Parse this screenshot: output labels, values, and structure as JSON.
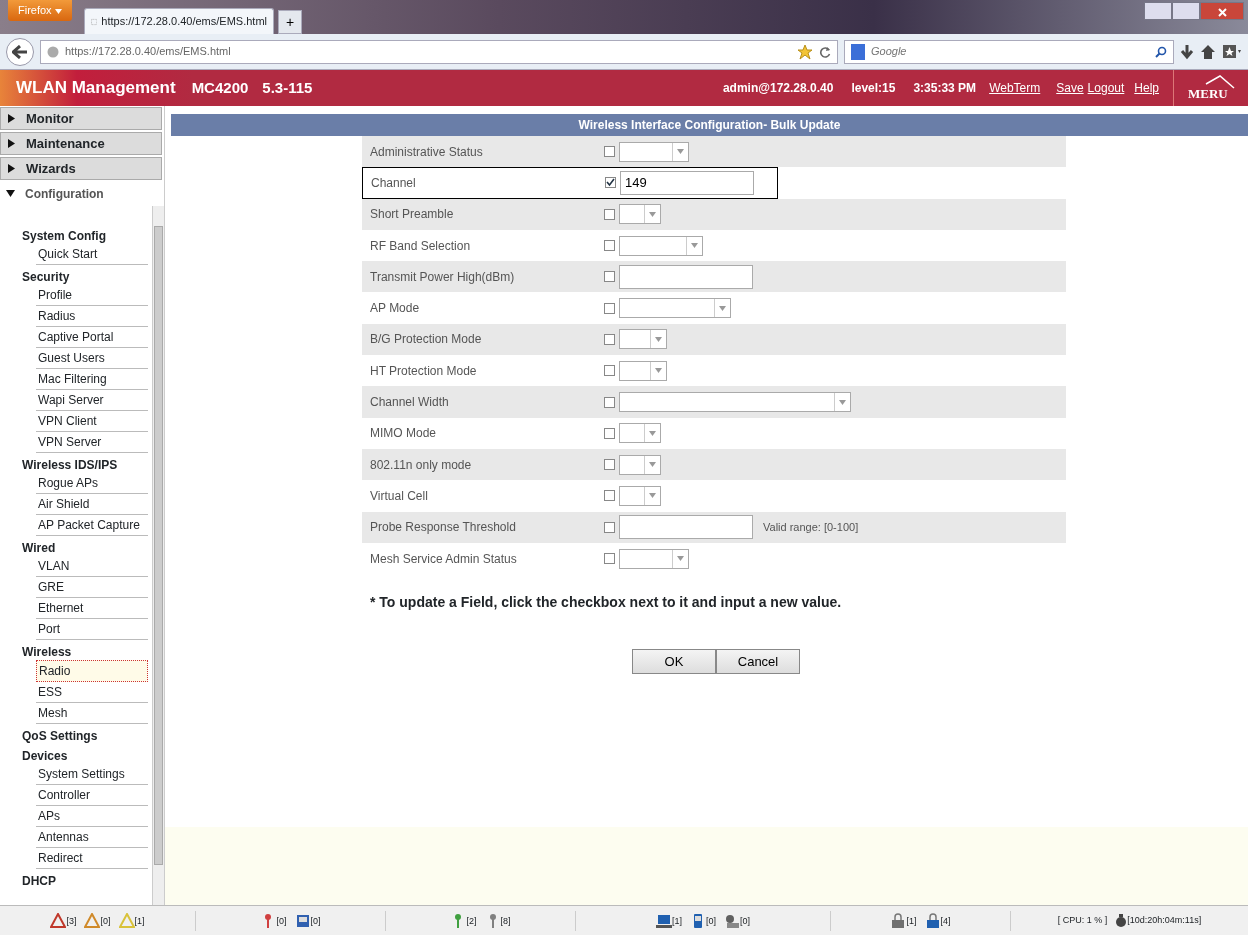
{
  "browser": {
    "menu_button": "Firefox",
    "tab_title": "https://172.28.0.40/ems/EMS.html",
    "new_tab": "+",
    "address": "https://172.28.0.40/ems/EMS.html",
    "search_placeholder": "Google"
  },
  "header": {
    "title": "WLAN Management",
    "model": "MC4200",
    "version": "5.3-115",
    "user": "admin@172.28.0.40",
    "level": "level:15",
    "time": "3:35:33 PM",
    "links": [
      "WebTerm",
      "Save",
      "Logout",
      "Help"
    ],
    "logo": "MERU"
  },
  "sidebar": {
    "sections": [
      {
        "label": "Monitor",
        "expanded": false
      },
      {
        "label": "Maintenance",
        "expanded": false
      },
      {
        "label": "Wizards",
        "expanded": false
      },
      {
        "label": "Configuration",
        "expanded": true
      }
    ],
    "groups": [
      {
        "label": "System Config",
        "children": [
          {
            "label": "Quick Start",
            "selected": false
          }
        ]
      },
      {
        "label": "Security",
        "children": [
          {
            "label": "Profile",
            "selected": false
          },
          {
            "label": "Radius",
            "selected": false
          },
          {
            "label": "Captive Portal",
            "selected": false
          },
          {
            "label": "Guest Users",
            "selected": false
          },
          {
            "label": "Mac Filtering",
            "selected": false
          },
          {
            "label": "Wapi Server",
            "selected": false
          },
          {
            "label": "VPN Client",
            "selected": false
          },
          {
            "label": "VPN Server",
            "selected": false
          }
        ]
      },
      {
        "label": "Wireless IDS/IPS",
        "children": [
          {
            "label": "Rogue APs",
            "selected": false
          },
          {
            "label": "Air Shield",
            "selected": false
          },
          {
            "label": "AP Packet Capture",
            "selected": false
          }
        ]
      },
      {
        "label": "Wired",
        "children": [
          {
            "label": "VLAN",
            "selected": false
          },
          {
            "label": "GRE",
            "selected": false
          },
          {
            "label": "Ethernet",
            "selected": false
          },
          {
            "label": "Port",
            "selected": false
          }
        ]
      },
      {
        "label": "Wireless",
        "children": [
          {
            "label": "Radio",
            "selected": true
          },
          {
            "label": "ESS",
            "selected": false
          },
          {
            "label": "Mesh",
            "selected": false
          }
        ]
      },
      {
        "label": "QoS Settings"
      },
      {
        "label": "Devices",
        "children": [
          {
            "label": "System Settings",
            "selected": false
          },
          {
            "label": "Controller",
            "selected": false
          },
          {
            "label": "APs",
            "selected": false
          },
          {
            "label": "Antennas",
            "selected": false
          },
          {
            "label": "Redirect",
            "selected": false
          }
        ]
      },
      {
        "label": "DHCP"
      }
    ]
  },
  "form": {
    "title": "Wireless Interface Configuration- Bulk Update",
    "rows": [
      {
        "label": "Administrative Status",
        "kind": "select",
        "checked": false,
        "outlined": false
      },
      {
        "label": "Channel",
        "kind": "text",
        "checked": true,
        "value": "149",
        "outlined": true
      },
      {
        "label": "Short Preamble",
        "kind": "select",
        "checked": false,
        "outlined": false
      },
      {
        "label": "RF Band Selection",
        "kind": "select",
        "checked": false,
        "outlined": false
      },
      {
        "label": "Transmit Power High(dBm)",
        "kind": "text",
        "checked": false,
        "outlined": false
      },
      {
        "label": "AP Mode",
        "kind": "select",
        "checked": false,
        "outlined": false
      },
      {
        "label": "B/G Protection Mode",
        "kind": "select",
        "checked": false,
        "outlined": false
      },
      {
        "label": "HT Protection Mode",
        "kind": "select",
        "checked": false,
        "outlined": false
      },
      {
        "label": "Channel Width",
        "kind": "select",
        "checked": false,
        "outlined": false
      },
      {
        "label": "MIMO Mode",
        "kind": "select",
        "checked": false,
        "outlined": false
      },
      {
        "label": "802.11n only mode",
        "kind": "select",
        "checked": false,
        "outlined": false
      },
      {
        "label": "Virtual Cell",
        "kind": "select",
        "checked": false,
        "outlined": false
      },
      {
        "label": "Probe Response Threshold",
        "kind": "text",
        "checked": false,
        "hint": "Valid range: [0-100]",
        "outlined": false
      },
      {
        "label": "Mesh Service Admin Status",
        "kind": "select",
        "checked": false,
        "outlined": false
      }
    ],
    "note": "* To update a Field, click the checkbox next to it and input a new value.",
    "buttons": [
      "OK",
      "Cancel"
    ]
  },
  "status_bar": {
    "groups": [
      [
        {
          "kind": "warning",
          "color": "#c0392b",
          "count": "[3]"
        },
        {
          "kind": "warning",
          "color": "#d08a2a",
          "count": "[0]"
        },
        {
          "kind": "warning",
          "color": "#d9c23a",
          "count": "[1]"
        }
      ],
      [
        {
          "kind": "ap",
          "color": "#d04040",
          "count": "[0]"
        },
        {
          "kind": "radio",
          "color": "#3060b0",
          "count": "[0]"
        }
      ],
      [
        {
          "kind": "ap",
          "color": "#40a040",
          "count": "[2]"
        },
        {
          "kind": "ap",
          "color": "#808080",
          "count": "[8]"
        }
      ],
      [
        {
          "kind": "laptop",
          "color": "#2060b0",
          "count": "[1]"
        },
        {
          "kind": "phone",
          "color": "#2060b0",
          "count": "[0]"
        },
        {
          "kind": "station",
          "color": "#606060",
          "count": "[0]"
        }
      ],
      [
        {
          "kind": "lock",
          "color": "#707070",
          "count": "[1]"
        },
        {
          "kind": "lock",
          "color": "#2060b0",
          "count": "[4]"
        }
      ]
    ],
    "cpu": "[ CPU: 1 % ]",
    "uptime": "[10d:20h:04m:11s]"
  }
}
